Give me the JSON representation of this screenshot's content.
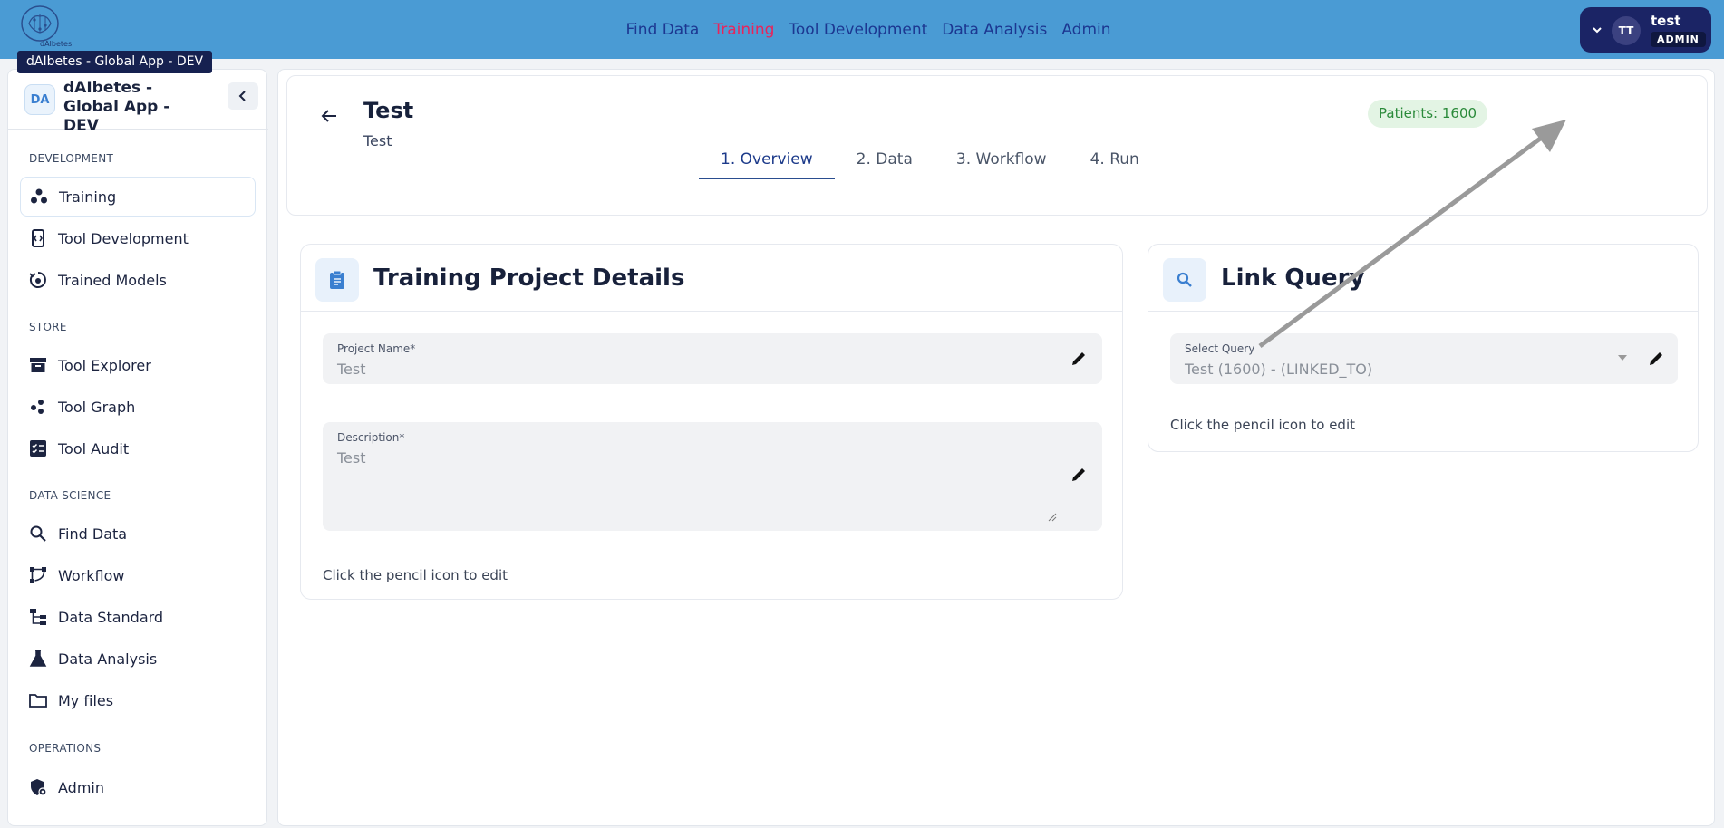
{
  "tooltip": "dAIbetes - Global App - DEV",
  "logo_text": "dAIbetes",
  "topnav": [
    {
      "label": "Find Data",
      "active": false
    },
    {
      "label": "Training",
      "active": true
    },
    {
      "label": "Tool Development",
      "active": false
    },
    {
      "label": "Data Analysis",
      "active": false
    },
    {
      "label": "Admin",
      "active": false
    }
  ],
  "user": {
    "initials": "TT",
    "name": "test",
    "role": "ADMIN"
  },
  "sidebar": {
    "badge": "DA",
    "title": "dAIbetes - Global App - DEV",
    "sections": [
      {
        "title": "DEVELOPMENT",
        "items": [
          {
            "label": "Training",
            "icon": "training-icon",
            "active": true
          },
          {
            "label": "Tool Development",
            "icon": "tool-development-icon"
          },
          {
            "label": "Trained Models",
            "icon": "trained-models-icon"
          }
        ]
      },
      {
        "title": "STORE",
        "items": [
          {
            "label": "Tool Explorer",
            "icon": "archive-icon"
          },
          {
            "label": "Tool Graph",
            "icon": "graph-icon"
          },
          {
            "label": "Tool Audit",
            "icon": "checklist-icon"
          }
        ]
      },
      {
        "title": "DATA SCIENCE",
        "items": [
          {
            "label": "Find Data",
            "icon": "search-icon"
          },
          {
            "label": "Workflow",
            "icon": "workflow-icon"
          },
          {
            "label": "Data Standard",
            "icon": "hierarchy-icon"
          },
          {
            "label": "Data Analysis",
            "icon": "flask-icon"
          },
          {
            "label": "My files",
            "icon": "folder-icon"
          }
        ]
      },
      {
        "title": "OPERATIONS",
        "items": [
          {
            "label": "Admin",
            "icon": "admin-shield-icon"
          }
        ]
      }
    ]
  },
  "project": {
    "title": "Test",
    "subtitle": "Test",
    "patients_label": "Patients:",
    "patients_count": "1600"
  },
  "tabs": [
    {
      "label": "1. Overview",
      "active": true
    },
    {
      "label": "2. Data"
    },
    {
      "label": "3. Workflow"
    },
    {
      "label": "4. Run"
    }
  ],
  "details_card": {
    "title": "Training Project Details",
    "name_label": "Project Name*",
    "name_value": "Test",
    "desc_label": "Description*",
    "desc_value": "Test",
    "hint": "Click the pencil icon to edit"
  },
  "query_card": {
    "title": "Link Query",
    "select_label": "Select Query",
    "select_value": "Test (1600) - (LINKED_TO)",
    "hint": "Click the pencil icon to edit"
  },
  "colors": {
    "topbar": "#4a9bd4",
    "active_nav": "#e8245b",
    "nav": "#1c3791",
    "user_chip": "#1b2465",
    "patients_bg": "#e3f4e4",
    "patients_text": "#2a8a3a"
  }
}
